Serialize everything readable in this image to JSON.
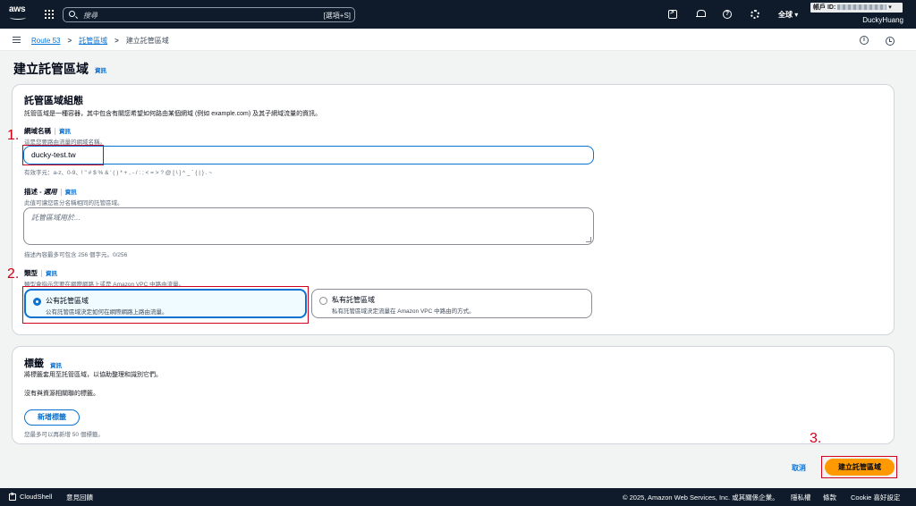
{
  "topnav": {
    "search_placeholder": "搜尋",
    "search_shortcut": "[選項+S]",
    "region": "全球 ▾",
    "account_label": "帳戶 ID:",
    "account_caret": "▾",
    "username": "DuckyHuang",
    "icons": [
      "aws-logo",
      "grid-icon",
      "search-icon",
      "cloudshell-icon",
      "bell-icon",
      "help-icon",
      "gear-icon"
    ]
  },
  "breadcrumb": {
    "items": [
      "Route 53",
      "託管區域",
      "建立託管區域"
    ],
    "separator": ">"
  },
  "page": {
    "title": "建立託管區域",
    "info": "資訊"
  },
  "config": {
    "heading": "託管區域組態",
    "description": "託管區域是一種容器，其中包含有關您希望如何路由某個網域 (例如 example.com) 及其子網域流量的資訊。",
    "domain_label": "網域名稱",
    "domain_info": "資訊",
    "domain_hint": "這是您要路由流量的網域名稱。",
    "domain_value": "ducky-test.tw",
    "domain_valid_chars": "有效字元：a-z、0-9、! \" # $ % & ' ( ) * + , - / : ; < = > ? @ [ \\ ] ^ _ ` { | } . ~",
    "desc_label": "描述 - ",
    "desc_optional": "選用",
    "desc_info": "資訊",
    "desc_hint": "此值可讓您區分名稱相同的託管區域。",
    "desc_placeholder": "託管區域用於...",
    "desc_counter": "描述內容最多可包含 256 個字元。0/256",
    "type_label": "類型",
    "type_info": "資訊",
    "type_hint": "類型會指示您要在網際網路上或是 Amazon VPC 中路由流量。",
    "public_title": "公有託管區域",
    "public_desc": "公有託管區域決定如何在網際網路上路由流量。",
    "private_title": "私有託管區域",
    "private_desc": "私有託管區域決定流量在 Amazon VPC 中路由的方式。"
  },
  "tags": {
    "heading": "標籤",
    "info": "資訊",
    "description": "將標籤套用至託管區域，以協助整理和識別它們。",
    "empty": "沒有與資源相關聯的標籤。",
    "add_button": "新增標籤",
    "limit": "您最多可以再新增 50 個標籤。"
  },
  "actions": {
    "cancel": "取消",
    "create": "建立託管區域"
  },
  "annotations": [
    "1.",
    "2.",
    "3."
  ],
  "footer": {
    "cloudshell": "CloudShell",
    "feedback": "意見回饋",
    "copyright": "© 2025, Amazon Web Services, Inc. 或其關係企業。",
    "privacy": "隱私權",
    "terms": "條款",
    "cookies": "Cookie 喜好設定"
  },
  "colors": {
    "nav_bg": "#0f1b2a",
    "link": "#0972d3",
    "primary_button": "#ff9900",
    "annotation": "#d0021b"
  }
}
